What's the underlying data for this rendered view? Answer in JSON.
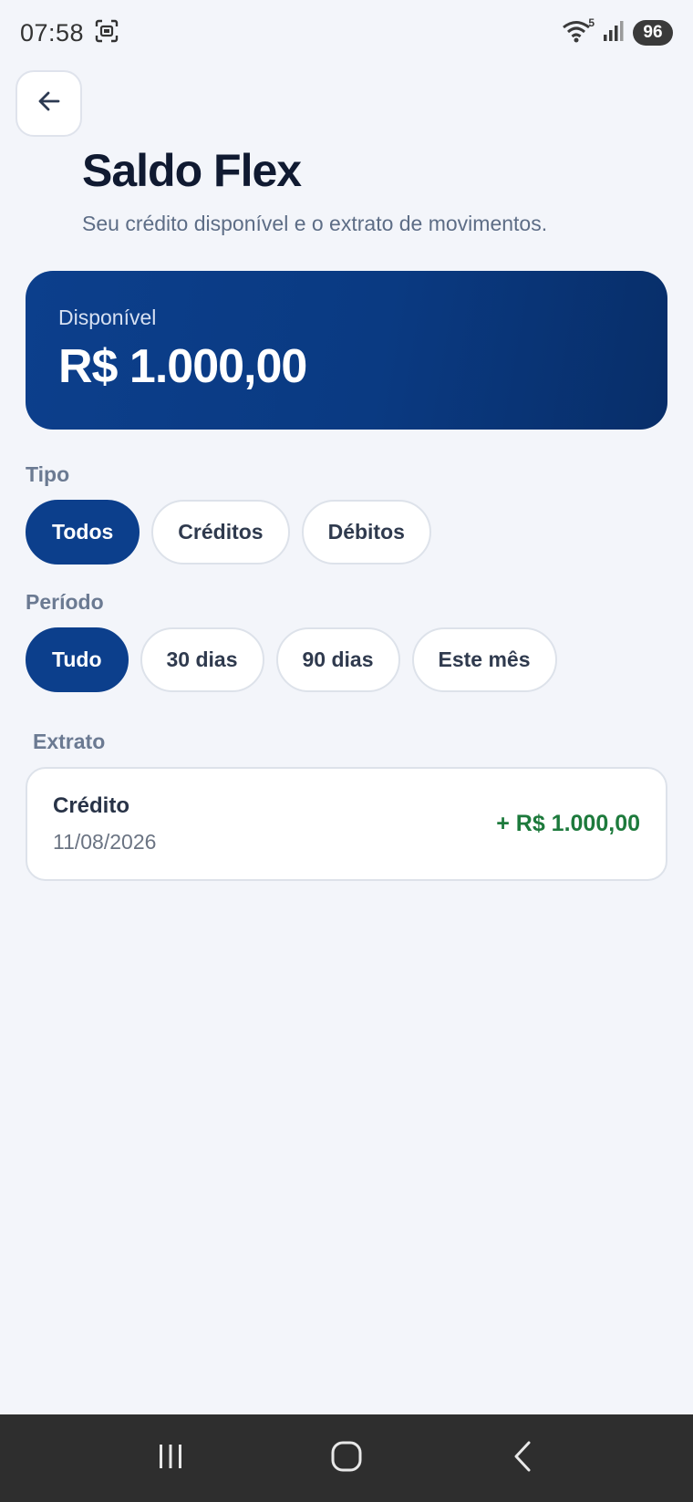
{
  "status_bar": {
    "time": "07:58",
    "battery": "96",
    "wifi_label": "5",
    "icons": [
      "screenshot-icon",
      "wifi-icon",
      "signal-icon",
      "battery-icon"
    ]
  },
  "header": {
    "title": "Saldo Flex",
    "subtitle": "Seu crédito disponível e o extrato de movimentos."
  },
  "balance": {
    "label": "Disponível",
    "value": "R$ 1.000,00"
  },
  "filters": {
    "type_label": "Tipo",
    "type_options": [
      "Todos",
      "Créditos",
      "Débitos"
    ],
    "type_selected": "Todos",
    "period_label": "Período",
    "period_options": [
      "Tudo",
      "30 dias",
      "90 dias",
      "Este mês"
    ],
    "period_selected": "Tudo"
  },
  "statement": {
    "label": "Extrato",
    "items": [
      {
        "title": "Crédito",
        "date": "11/08/2026",
        "amount": "+ R$ 1.000,00"
      }
    ]
  },
  "colors": {
    "primary": "#0c3f8c",
    "background": "#f3f5fa",
    "credit": "#1d7a3c"
  }
}
